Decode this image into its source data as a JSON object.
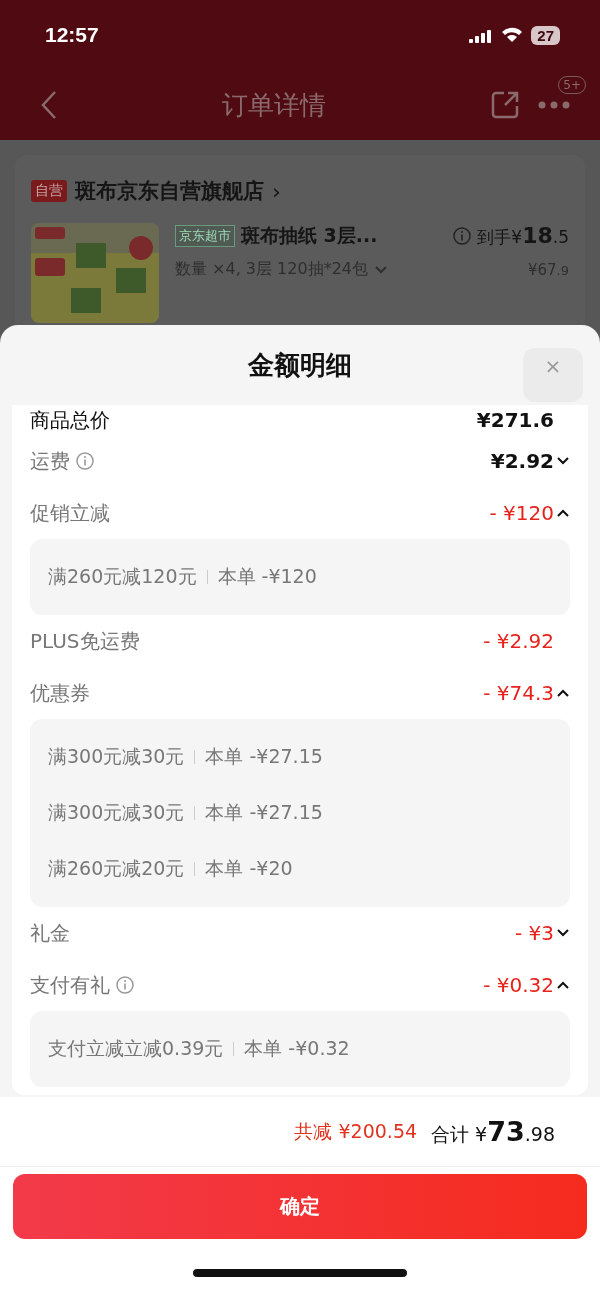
{
  "status_bar": {
    "time": "12:57",
    "battery": "27"
  },
  "nav": {
    "title": "订单详情",
    "badge": "5+"
  },
  "store": {
    "tag": "自营",
    "name": "斑布京东自营旗舰店",
    "chevron": "›"
  },
  "product": {
    "tag": "京东超市",
    "title": "斑布抽纸 3层...",
    "spec": "数量 ×4, 3层 120抽*24包",
    "price_label": "到手¥",
    "price_int": "18",
    "price_dec": ".5",
    "orig_int": "¥67",
    "orig_dec": ".9"
  },
  "sheet": {
    "title": "金额明细",
    "close": "×",
    "rows": [
      {
        "kind": "plain",
        "label": "商品总价",
        "amount": "¥271.6",
        "discount": false
      },
      {
        "kind": "toggle",
        "label": "运费",
        "amount": "¥2.92",
        "discount": false,
        "info": true,
        "expanded": false
      },
      {
        "kind": "toggle",
        "label": "促销立减",
        "amount": "- ¥120",
        "discount": true,
        "expanded": true,
        "details": [
          {
            "condition": "满260元减120元",
            "saving": "本单 -¥120"
          }
        ]
      },
      {
        "kind": "plain",
        "label": "PLUS免运费",
        "amount": "- ¥2.92",
        "discount": true
      },
      {
        "kind": "toggle",
        "label": "优惠券",
        "amount": "- ¥74.3",
        "discount": true,
        "expanded": true,
        "details": [
          {
            "condition": "满300元减30元",
            "saving": "本单 -¥27.15"
          },
          {
            "condition": "满300元减30元",
            "saving": "本单 -¥27.15"
          },
          {
            "condition": "满260元减20元",
            "saving": "本单 -¥20"
          }
        ]
      },
      {
        "kind": "toggle",
        "label": "礼金",
        "amount": "- ¥3",
        "discount": true,
        "expanded": false
      },
      {
        "kind": "toggle",
        "label": "支付有礼",
        "amount": "- ¥0.32",
        "discount": true,
        "info": true,
        "expanded": true,
        "details": [
          {
            "condition": "支付立减立减0.39元",
            "saving": "本单 -¥0.32"
          }
        ]
      }
    ],
    "savings_label": "共减",
    "savings": "¥200.54",
    "total_label": "合计",
    "total_symbol": "¥",
    "total_int": "73",
    "total_dec": ".98",
    "confirm": "确定"
  }
}
